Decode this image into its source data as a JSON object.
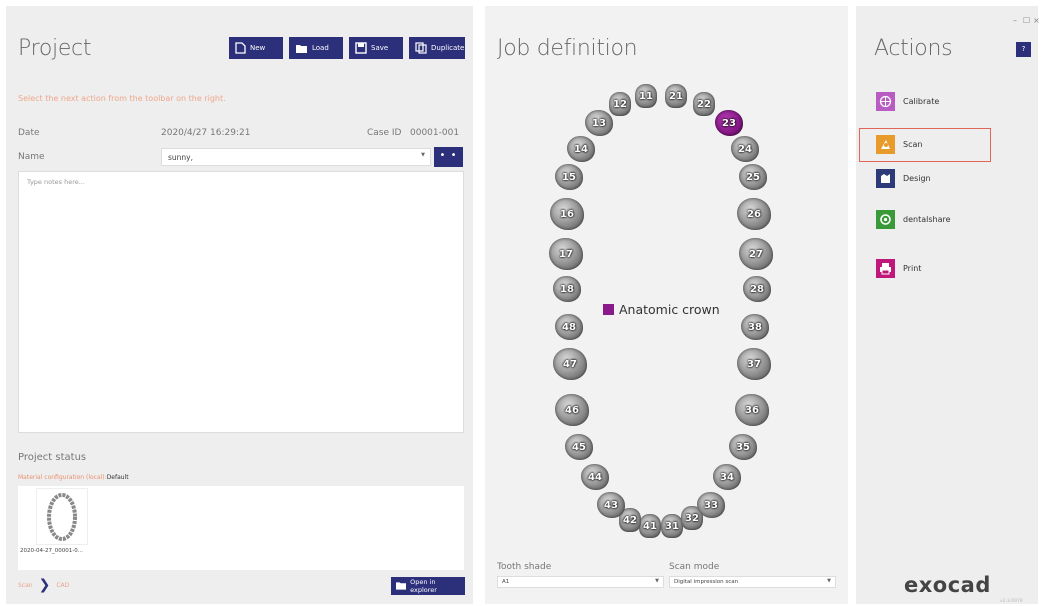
{
  "project": {
    "title": "Project",
    "toolbar": {
      "new": "New",
      "load": "Load",
      "save": "Save",
      "duplicate": "Duplicate"
    },
    "hint": "Select the next action from the toolbar on the right.",
    "date_label": "Date",
    "date_value": "2020/4/27  16:29:21",
    "case_id_label": "Case ID",
    "case_id_value": "00001-001",
    "name_label": "Name",
    "name_value": "sunny,",
    "name_options": "• • •",
    "notes_placeholder": "Type notes here...",
    "status_title": "Project status",
    "material_label": "Material configuration (local):",
    "material_value": "Default",
    "thumbnail_caption": "2020-04-27_00001-0...",
    "workflow": [
      "Scan",
      "CAD"
    ],
    "open_explorer": "Open in explorer"
  },
  "job": {
    "title": "Job definition",
    "teeth": [
      "11",
      "12",
      "13",
      "14",
      "15",
      "16",
      "17",
      "18",
      "21",
      "22",
      "23",
      "24",
      "25",
      "26",
      "27",
      "28",
      "31",
      "32",
      "33",
      "34",
      "35",
      "36",
      "37",
      "38",
      "41",
      "42",
      "43",
      "44",
      "45",
      "46",
      "47",
      "48"
    ],
    "selected_tooth": "23",
    "legend_label": "Anatomic crown",
    "legend_color": "#8a1a8a",
    "tooth_shade_label": "Tooth shade",
    "tooth_shade_value": "A1",
    "scan_mode_label": "Scan mode",
    "scan_mode_value": "Digital impression scan"
  },
  "actions": {
    "title": "Actions",
    "help": "?",
    "items": [
      {
        "label": "Calibrate",
        "icon": "calibrate-icon",
        "color": "#b85cc4"
      },
      {
        "label": "Scan",
        "icon": "scan-icon",
        "color": "#e89a2a"
      },
      {
        "label": "Design",
        "icon": "design-icon",
        "color": "#2c3a7a"
      },
      {
        "label": "dentalshare",
        "icon": "dentalshare-icon",
        "color": "#3a9a3a"
      },
      {
        "label": "Print",
        "icon": "print-icon",
        "color": "#c0187a"
      }
    ],
    "highlighted": "Scan",
    "window_controls": [
      "–",
      "☐",
      "×"
    ],
    "logo": "exocad",
    "version": "v2.3.6978"
  },
  "colors": {
    "accent": "#2c2f7a",
    "hint": "#f0a78a",
    "highlight_border": "#e2655a"
  }
}
